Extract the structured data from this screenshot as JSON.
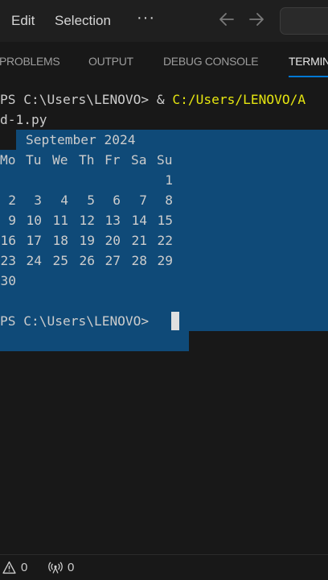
{
  "menu": {
    "edit": "Edit",
    "selection": "Selection",
    "more": "···"
  },
  "panel_tabs": [
    "PROBLEMS",
    "OUTPUT",
    "DEBUG CONSOLE",
    "TERMINAL"
  ],
  "terminal": {
    "line1_prompt": "PS C:\\Users\\LENOVO> & ",
    "line1_path": "C:/Users/LENOVO/A",
    "line2": "d-1.py",
    "calendar_title": "September 2024",
    "weekdays": [
      "Mo",
      "Tu",
      "We",
      "Th",
      "Fr",
      "Sa",
      "Su"
    ],
    "weeks": [
      [
        "",
        "",
        "",
        "",
        "",
        "",
        "1"
      ],
      [
        "2",
        "3",
        "4",
        "5",
        "6",
        "7",
        "8"
      ],
      [
        "9",
        "10",
        "11",
        "12",
        "13",
        "14",
        "15"
      ],
      [
        "16",
        "17",
        "18",
        "19",
        "20",
        "21",
        "22"
      ],
      [
        "23",
        "24",
        "25",
        "26",
        "27",
        "28",
        "29"
      ],
      [
        "30",
        "",
        "",
        "",
        "",
        "",
        ""
      ]
    ],
    "final_prompt": "PS C:\\Users\\LENOVO> "
  },
  "status": {
    "problems_count": "0",
    "ports_count": "0"
  },
  "colors": {
    "selection": "#0f4a78",
    "path_yellow": "#e5e510",
    "accent": "#0078d4"
  }
}
